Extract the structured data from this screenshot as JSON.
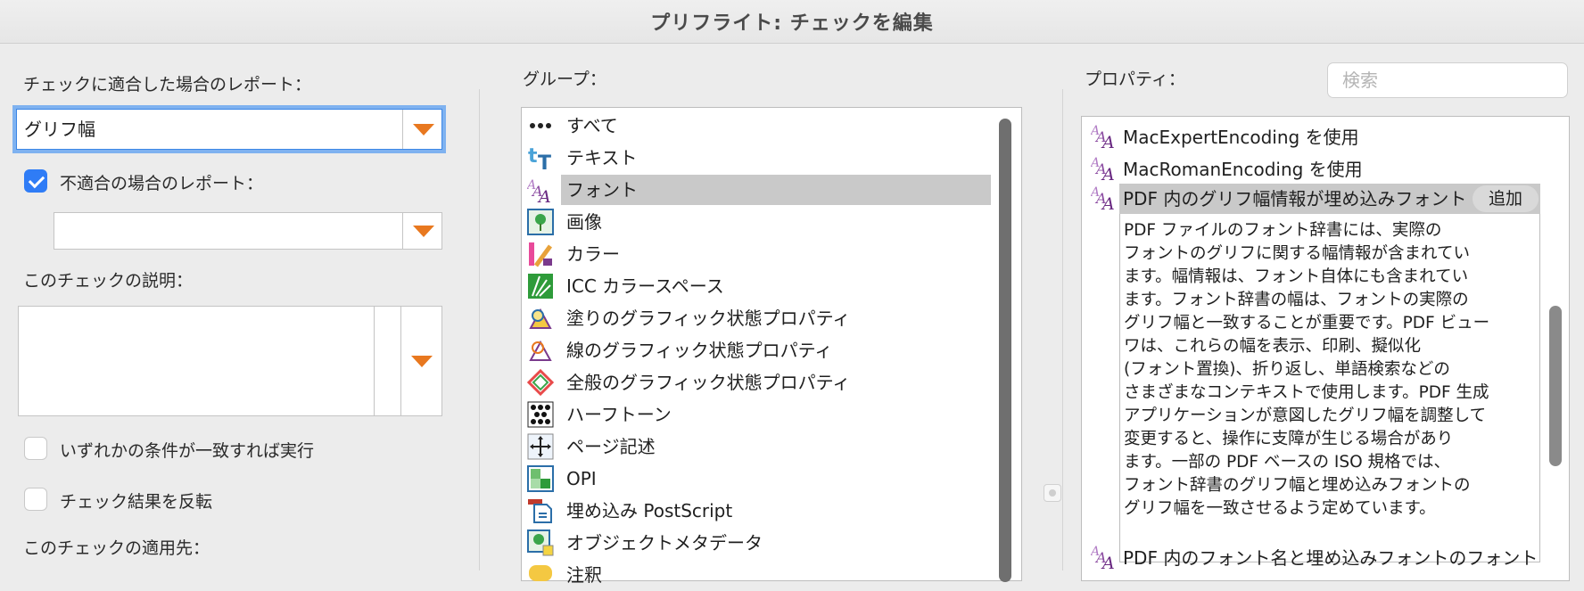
{
  "window": {
    "title": "プリフライト: チェックを編集"
  },
  "left": {
    "report_if_match_label": "チェックに適合した場合のレポート：",
    "report_if_match_value": "グリフ幅",
    "report_if_not_match_label": "不適合の場合のレポート：",
    "report_if_not_match_checked": true,
    "report_if_not_match_value": "",
    "description_label": "このチェックの説明：",
    "description_value": "",
    "any_condition_label": "いずれかの条件が一致すれば実行",
    "invert_label": "チェック結果を反転",
    "apply_to_label": "このチェックの適用先："
  },
  "groups": {
    "label": "グループ：",
    "selected_index": 2,
    "items": [
      {
        "label": "すべて",
        "icon": "more-icon"
      },
      {
        "label": "テキスト",
        "icon": "text-icon"
      },
      {
        "label": "フォント",
        "icon": "font-icon"
      },
      {
        "label": "画像",
        "icon": "image-icon"
      },
      {
        "label": "カラー",
        "icon": "color-icon"
      },
      {
        "label": "ICC カラースペース",
        "icon": "icc-icon"
      },
      {
        "label": "塗りのグラフィック状態プロパティ",
        "icon": "fill-state-icon"
      },
      {
        "label": "線のグラフィック状態プロパティ",
        "icon": "stroke-state-icon"
      },
      {
        "label": "全般のグラフィック状態プロパティ",
        "icon": "general-state-icon"
      },
      {
        "label": "ハーフトーン",
        "icon": "halftone-icon"
      },
      {
        "label": "ページ記述",
        "icon": "page-description-icon"
      },
      {
        "label": "OPI",
        "icon": "opi-icon"
      },
      {
        "label": "埋め込み PostScript",
        "icon": "postscript-icon"
      },
      {
        "label": "オブジェクトメタデータ",
        "icon": "metadata-icon"
      },
      {
        "label": "注釈",
        "icon": "annotation-icon"
      }
    ]
  },
  "properties": {
    "label": "プロパティ：",
    "search_placeholder": "検索",
    "items": [
      {
        "label": "MacExpertEncoding を使用"
      },
      {
        "label": "MacRomanEncoding を使用"
      },
      {
        "label": "PDF 内のグリフ幅情報が埋め込みフォント"
      },
      {
        "label": "PDF 内のフォント名と埋め込みフォントのフォント"
      }
    ],
    "add_button": "追加",
    "detail_lines": [
      "PDF ファイルのフォント辞書には、実際の",
      "フォントのグリフに関する幅情報が含まれてい",
      "ます。幅情報は、フォント自体にも含まれてい",
      "ます。フォント辞書の幅は、フォントの実際の",
      "グリフ幅と一致することが重要です。PDF ビュー",
      "ワは、これらの幅を表示、印刷、擬似化",
      "(フォント置換)、折り返し、単語検索などの",
      "さまざまなコンテキストで使用します。PDF 生成",
      "アプリケーションが意図したグリフ幅を調整して",
      "変更すると、操作に支障が生じる場合があり",
      "ます。一部の PDF ベースの ISO 規格では、",
      "フォント辞書のグリフ幅と埋め込みフォントの",
      "グリフ幅を一致させるよう定めています。"
    ]
  },
  "colors": {
    "accent": "#2f7cf6",
    "arrow": "#e8781f",
    "selection": "#c9c9c9",
    "font_icon": "#7a3a8c"
  }
}
